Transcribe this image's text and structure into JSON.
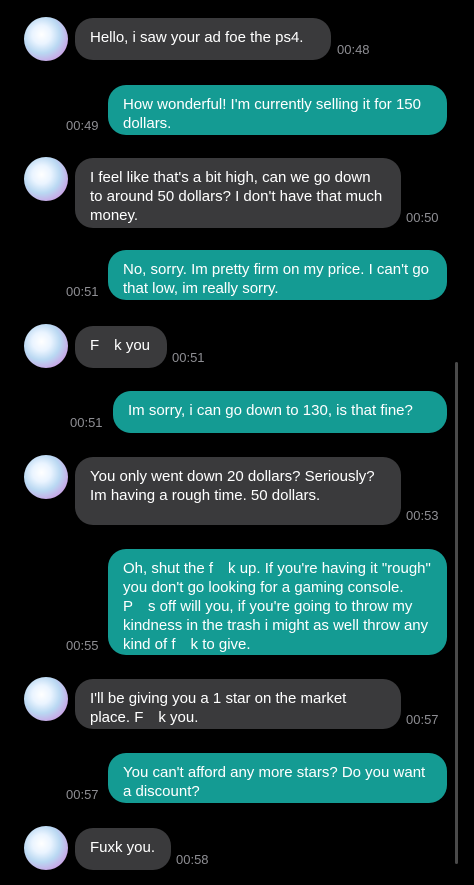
{
  "chat": {
    "messages": [
      {
        "sender": "them",
        "text": "Hello, i saw your ad foe the ps4.",
        "time": "00:48"
      },
      {
        "sender": "me",
        "text": "How wonderful! I'm currently selling it for 150 dollars.",
        "time": "00:49"
      },
      {
        "sender": "them",
        "text": "I feel like that's a bit high, can we go down to around 50 dollars? I don't have that much money.",
        "time": "00:50"
      },
      {
        "sender": "me",
        "text": "No, sorry. Im pretty firm on my price. I can't go that low, im really sorry.",
        "time": "00:51"
      },
      {
        "sender": "them",
        "text": "F k you",
        "time": "00:51"
      },
      {
        "sender": "me",
        "text": "Im sorry, i can go down to 130, is that fine?",
        "time": "00:51"
      },
      {
        "sender": "them",
        "text": "You only went down 20 dollars? Seriously? Im having a rough time. 50 dollars.",
        "time": "00:53"
      },
      {
        "sender": "me",
        "text": "Oh, shut the f k up. If you're having it \"rough\" you don't go looking for a gaming console. P s off will you, if you're going to throw my kindness in the trash i might as well throw any kind of f k to give.",
        "time": "00:55"
      },
      {
        "sender": "them",
        "text": "I'll be giving you a 1 star on the market place. F k you.",
        "time": "00:57"
      },
      {
        "sender": "me",
        "text": "You can't afford any more stars? Do you want a discount?",
        "time": "00:57"
      },
      {
        "sender": "them",
        "text": "Fuxk you.",
        "time": "00:58"
      }
    ]
  },
  "colors": {
    "background": "#000000",
    "incoming_bubble": "#3a3a3c",
    "outgoing_bubble": "#149b93",
    "timestamp": "#8e8e93"
  },
  "icons": {
    "avatar": "contact-avatar-gradient"
  }
}
